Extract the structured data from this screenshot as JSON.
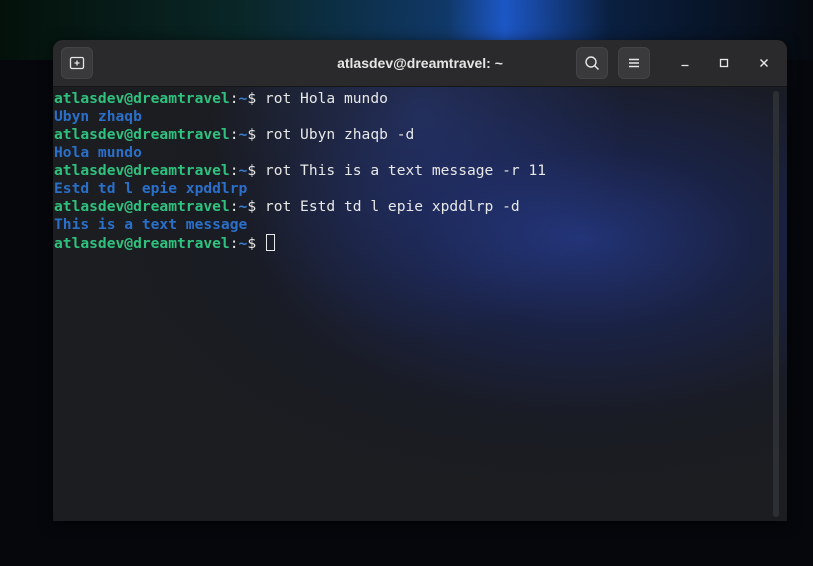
{
  "window": {
    "title": "atlasdev@dreamtravel: ~"
  },
  "titlebar": {
    "new_tab_icon": "new-tab-icon",
    "search_icon": "search-icon",
    "menu_icon": "hamburger-menu-icon",
    "minimize_icon": "minimize-icon",
    "maximize_icon": "maximize-icon",
    "close_icon": "close-icon"
  },
  "colors": {
    "prompt_user": "#2ec27e",
    "prompt_path": "#3a7fd6",
    "output": "#2a6fc9",
    "terminal_bg": "#1b1d20",
    "titlebar_bg": "#2a2a2c"
  },
  "terminal": {
    "prompt": {
      "user_host": "atlasdev@dreamtravel",
      "separator": ":",
      "path": "~",
      "symbol": "$ "
    },
    "lines": [
      {
        "type": "command",
        "text": "rot Hola mundo"
      },
      {
        "type": "output",
        "text": "Ubyn zhaqb"
      },
      {
        "type": "command",
        "text": "rot Ubyn zhaqb -d"
      },
      {
        "type": "output",
        "text": "Hola mundo"
      },
      {
        "type": "command",
        "text": "rot This is a text message -r 11"
      },
      {
        "type": "output",
        "text": "Estd td l epie xpddlrp"
      },
      {
        "type": "command",
        "text": "rot Estd td l epie xpddlrp -d"
      },
      {
        "type": "output",
        "text": "This is a text message"
      },
      {
        "type": "command",
        "text": ""
      }
    ]
  }
}
